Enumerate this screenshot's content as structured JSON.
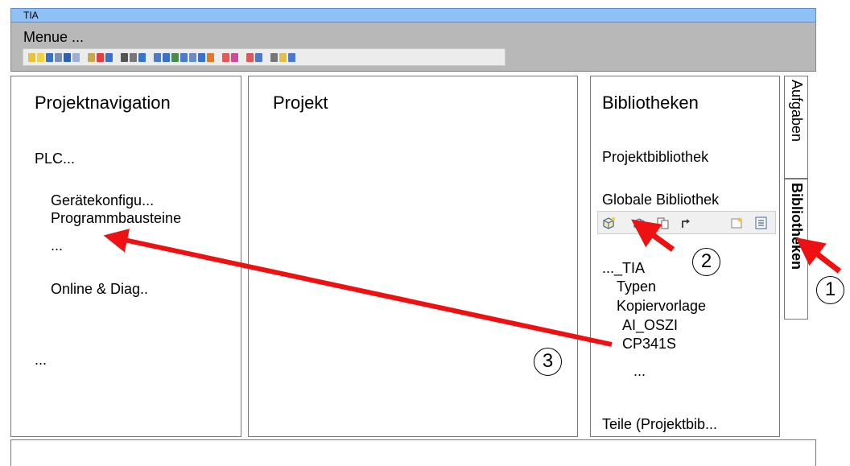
{
  "window": {
    "title": "TIA"
  },
  "menu": {
    "label": "Menue ..."
  },
  "toolbar_icon_colors": [
    "#e8c33a",
    "#f0d24a",
    "#3b72c9",
    "#7a8fb0",
    "#2b5fb8",
    "#9bb0d0",
    "#c8a94a",
    "#e04040",
    "#3b72c9",
    "#555555",
    "#777777",
    "#3a74c9",
    "#4a7ac9",
    "#3b72c9",
    "#4a8a4a",
    "#4a7ac9",
    "#6a8ac9",
    "#3b72c9",
    "#e07a2a",
    "#e05a5a",
    "#d04a9a",
    "#d95a5a",
    "#4a7ac9",
    "#777777",
    "#e0c04a",
    "#4a7ac9"
  ],
  "project_nav": {
    "title": "Projektnavigation",
    "plc": "PLC...",
    "device_config": "Gerätekonfigu...",
    "program_blocks": "Programmbausteine",
    "ellipsis1": "...",
    "online_diag": "Online & Diag..",
    "ellipsis2": "..."
  },
  "project": {
    "title": "Projekt"
  },
  "libraries": {
    "title": "Bibliotheken",
    "project_library": "Projektbibliothek",
    "global_library": "Globale Bibliothek",
    "tree_root": "..._TIA",
    "types": "Typen",
    "master_copies": "Kopiervorlage",
    "item_ai_oszi": "AI_OSZI",
    "item_cp341s": "CP341S",
    "ellipsis": "...",
    "parts": "Teile (Projektbib..."
  },
  "side_tabs": {
    "tasks": "Aufgaben",
    "libraries": "Bibliotheken"
  },
  "callouts": {
    "one": "1",
    "two": "2",
    "three": "3"
  },
  "colors": {
    "arrow": "#ee1111",
    "title_bar": "#8ec1f7",
    "menu_bar": "#b8b8b8"
  }
}
